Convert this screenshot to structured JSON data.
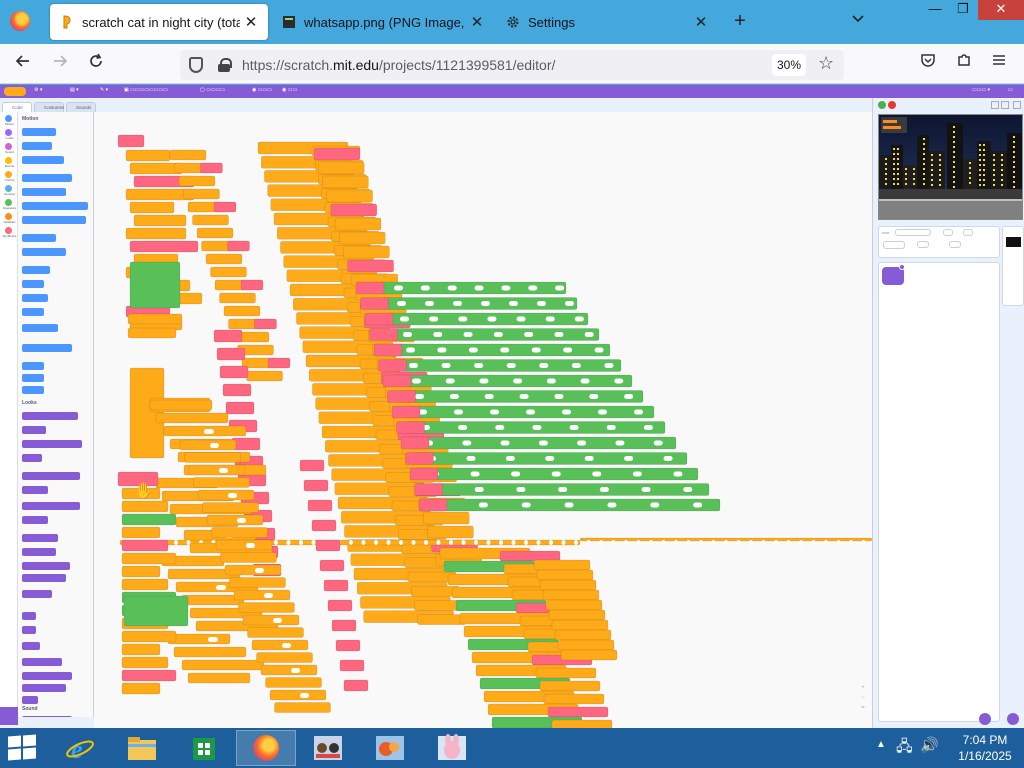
{
  "browser": {
    "tabs": [
      {
        "title": "scratch cat in night city (totally",
        "icon": "scratch-favicon",
        "active": true
      },
      {
        "title": "whatsapp.png (PNG Image, 34",
        "icon": "image-favicon",
        "active": false
      },
      {
        "title": "Settings",
        "icon": "gear-icon",
        "active": false
      }
    ],
    "url_prefix": "https://scratch.",
    "url_domain": "mit.edu",
    "url_path": "/projects/1121399581/editor/",
    "zoom": "30%",
    "window_controls": {
      "minimize": "—",
      "restore": "❐",
      "close": "✕"
    }
  },
  "scratch": {
    "editor_tabs": [
      "Code",
      "Costumes",
      "Sounds"
    ],
    "categories": [
      {
        "name": "Motion",
        "color": "#4c97ff"
      },
      {
        "name": "Looks",
        "color": "#9966ff"
      },
      {
        "name": "Sound",
        "color": "#cf63cf"
      },
      {
        "name": "Events",
        "color": "#ffbf00"
      },
      {
        "name": "Control",
        "color": "#ffab19"
      },
      {
        "name": "Sensing",
        "color": "#5cb1d6"
      },
      {
        "name": "Operators",
        "color": "#59c059"
      },
      {
        "name": "Variables",
        "color": "#ff8c1a"
      },
      {
        "name": "My Blocks",
        "color": "#ff6680"
      }
    ],
    "palette_headers": [
      "Motion",
      "Looks",
      "Sound"
    ],
    "zoom_controls": [
      "+",
      "−",
      "="
    ]
  },
  "taskbar": {
    "apps": [
      "internet-explorer",
      "file-explorer",
      "store",
      "firefox",
      "app-1",
      "app-2",
      "app-3"
    ],
    "time": "7:04 PM",
    "date": "1/16/2025"
  },
  "colors": {
    "scratch_purple": "#855cd6",
    "block_orange": "#ffab19",
    "block_green": "#59c059",
    "block_pink": "#ff6680",
    "block_blue": "#4c97ff"
  }
}
